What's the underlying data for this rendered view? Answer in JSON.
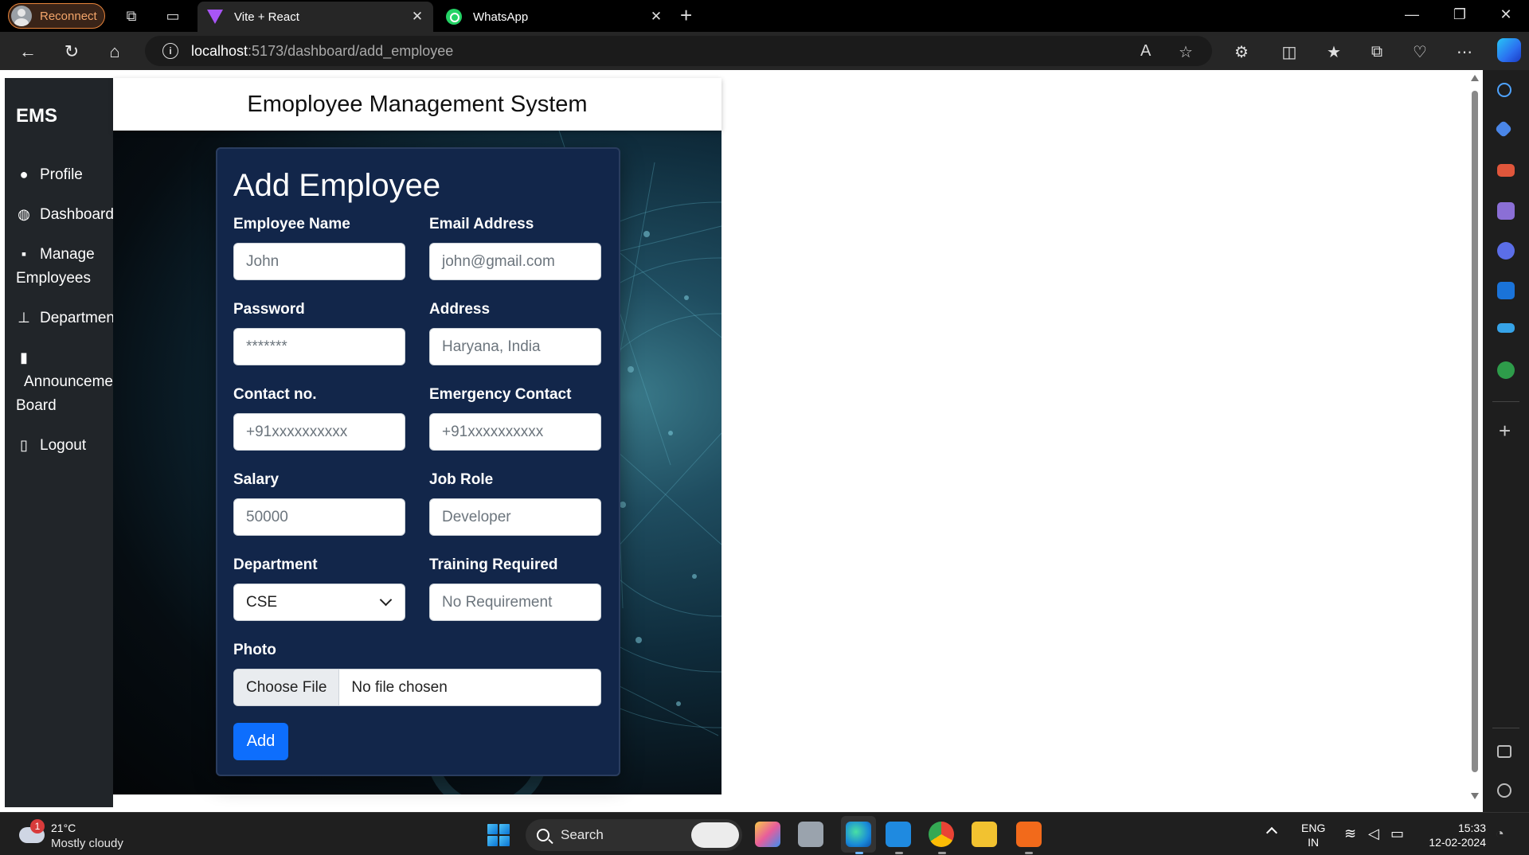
{
  "browser": {
    "profile_label": "Reconnect",
    "tabs": [
      {
        "title": "Vite + React",
        "icon": "vite-icon",
        "active": true
      },
      {
        "title": "WhatsApp",
        "icon": "whatsapp-icon",
        "active": false
      }
    ],
    "url_host": "localhost",
    "url_path": ":5173/dashboard/add_employee"
  },
  "sidebar": {
    "brand": "EMS",
    "items": [
      {
        "label": "Profile",
        "icon": "person-icon"
      },
      {
        "label": "Dashboard",
        "icon": "palette-icon"
      },
      {
        "label_line1": "Manage",
        "label_line2": "Employees",
        "icon": "people-icon"
      },
      {
        "label": "Departments",
        "icon": "diagram-icon"
      },
      {
        "label_line1": "Announcement",
        "label_line2": "Board",
        "icon": "clipboard-icon"
      },
      {
        "label": "Logout",
        "icon": "door-icon"
      }
    ]
  },
  "header": {
    "title": "Emoployee Management System"
  },
  "form": {
    "title": "Add Employee",
    "fields": {
      "name": {
        "label": "Employee Name",
        "placeholder": "John"
      },
      "email": {
        "label": "Email Address",
        "placeholder": "john@gmail.com"
      },
      "password": {
        "label": "Password",
        "placeholder": "*******"
      },
      "address": {
        "label": "Address",
        "placeholder": "Haryana, India"
      },
      "contact": {
        "label": "Contact no.",
        "placeholder": "+91xxxxxxxxxx"
      },
      "emergency": {
        "label": "Emergency Contact",
        "placeholder": "+91xxxxxxxxxx"
      },
      "salary": {
        "label": "Salary",
        "placeholder": "50000"
      },
      "job_role": {
        "label": "Job Role",
        "placeholder": "Developer"
      },
      "department": {
        "label": "Department",
        "value": "CSE"
      },
      "training": {
        "label": "Training Required",
        "placeholder": "No Requirement"
      },
      "photo": {
        "label": "Photo",
        "button": "Choose File",
        "status": "No file chosen"
      }
    },
    "submit_label": "Add"
  },
  "taskbar": {
    "weather_temp": "21°C",
    "weather_desc": "Mostly cloudy",
    "weather_badge": "1",
    "search_label": "Search",
    "lang_line1": "ENG",
    "lang_line2": "IN",
    "time": "15:33",
    "date": "12-02-2024"
  },
  "colors": {
    "sidebar_bg": "#212529",
    "card_bg": "#12264a",
    "primary_button": "#0d6efd"
  }
}
